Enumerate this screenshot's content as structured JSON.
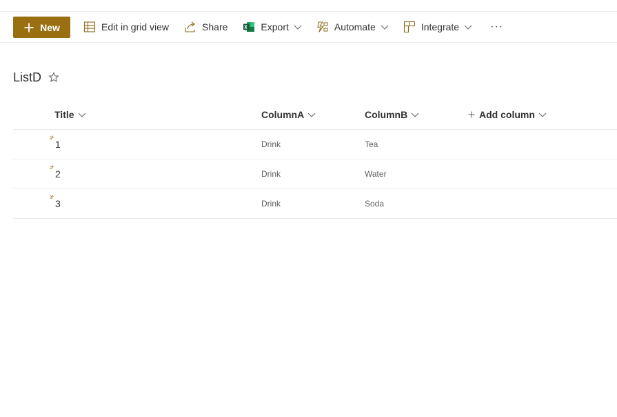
{
  "commandbar": {
    "new_label": "New",
    "edit_grid_label": "Edit in grid view",
    "share_label": "Share",
    "export_label": "Export",
    "automate_label": "Automate",
    "integrate_label": "Integrate",
    "more_label": "···"
  },
  "list": {
    "title": "ListD"
  },
  "table": {
    "columns": {
      "title": "Title",
      "column_a": "ColumnA",
      "column_b": "ColumnB",
      "add_column": "Add column"
    },
    "rows": [
      {
        "title": "1",
        "column_a": "Drink",
        "column_b": "Tea"
      },
      {
        "title": "2",
        "column_a": "Drink",
        "column_b": "Water"
      },
      {
        "title": "3",
        "column_a": "Drink",
        "column_b": "Soda"
      }
    ]
  },
  "colors": {
    "accent": "#9a6f12",
    "excel_green": "#107c41",
    "divider": "#edebe9"
  },
  "icons": {
    "new": "plus-icon",
    "edit_grid": "grid-icon",
    "share": "share-icon",
    "export": "excel-icon",
    "automate": "flow-icon",
    "integrate": "integrate-icon",
    "favorite": "star-icon",
    "new_item": "new-item-sparkle-icon"
  }
}
